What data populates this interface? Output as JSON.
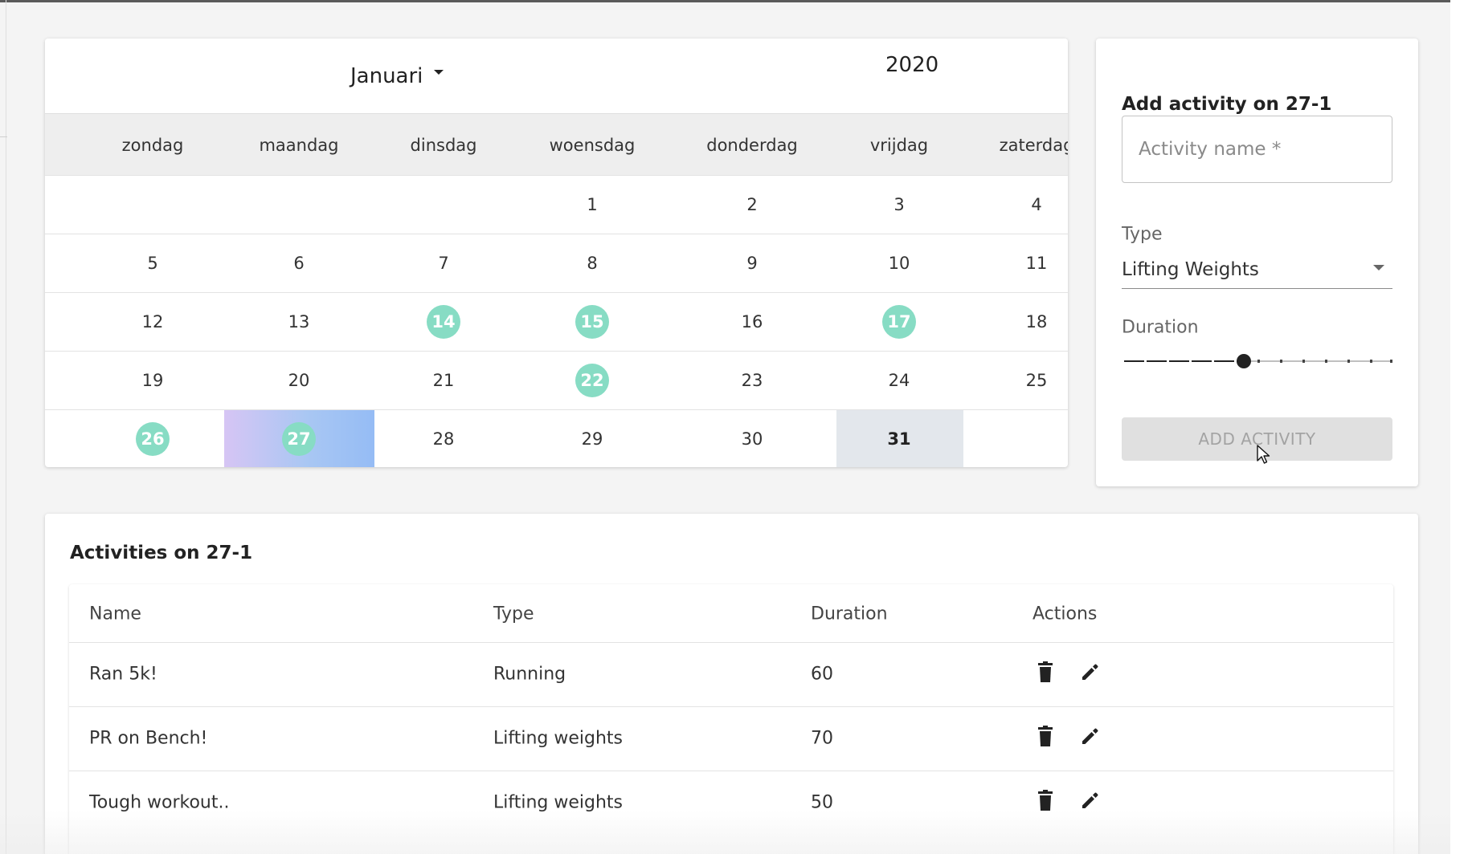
{
  "calendar": {
    "month": "Januari",
    "year": "2020",
    "weekdays": [
      "zondag",
      "maandag",
      "dinsdag",
      "woensdag",
      "donderdag",
      "vrijdag",
      "zaterdag"
    ],
    "weeks": [
      [
        "",
        "",
        "",
        "1",
        "2",
        "3",
        "4"
      ],
      [
        "5",
        "6",
        "7",
        "8",
        "9",
        "10",
        "11"
      ],
      [
        "12",
        "13",
        "14",
        "15",
        "16",
        "17",
        "18"
      ],
      [
        "19",
        "20",
        "21",
        "22",
        "23",
        "24",
        "25"
      ],
      [
        "26",
        "27",
        "28",
        "29",
        "30",
        "31",
        ""
      ]
    ],
    "days_with_activity": [
      "14",
      "15",
      "17",
      "22",
      "26",
      "27"
    ],
    "selected_day": "27",
    "today": "31",
    "colors": {
      "activity_dot": "#87dcc4",
      "selected_gradient_start": "#d6c5f4",
      "selected_gradient_end": "#95bcf5",
      "today_highlight": "#e3e7ec"
    }
  },
  "add_activity": {
    "title": "Add activity on 27-1",
    "name_placeholder": "Activity name *",
    "name_value": "",
    "type_label": "Type",
    "type_value": "Lifting Weights",
    "duration_label": "Duration",
    "duration_fraction": 0.45,
    "duration_marks": 12,
    "button_label": "ADD ACTIVITY",
    "button_disabled": true
  },
  "activities": {
    "title": "Activities on 27-1",
    "columns": [
      "Name",
      "Type",
      "Duration",
      "Actions"
    ],
    "rows": [
      {
        "name": "Ran 5k!",
        "type": "Running",
        "duration": "60"
      },
      {
        "name": "PR on Bench!",
        "type": "Lifting weights",
        "duration": "70"
      },
      {
        "name": "Tough workout..",
        "type": "Lifting weights",
        "duration": "50"
      }
    ],
    "row_actions": [
      "delete-icon",
      "edit-icon"
    ]
  }
}
